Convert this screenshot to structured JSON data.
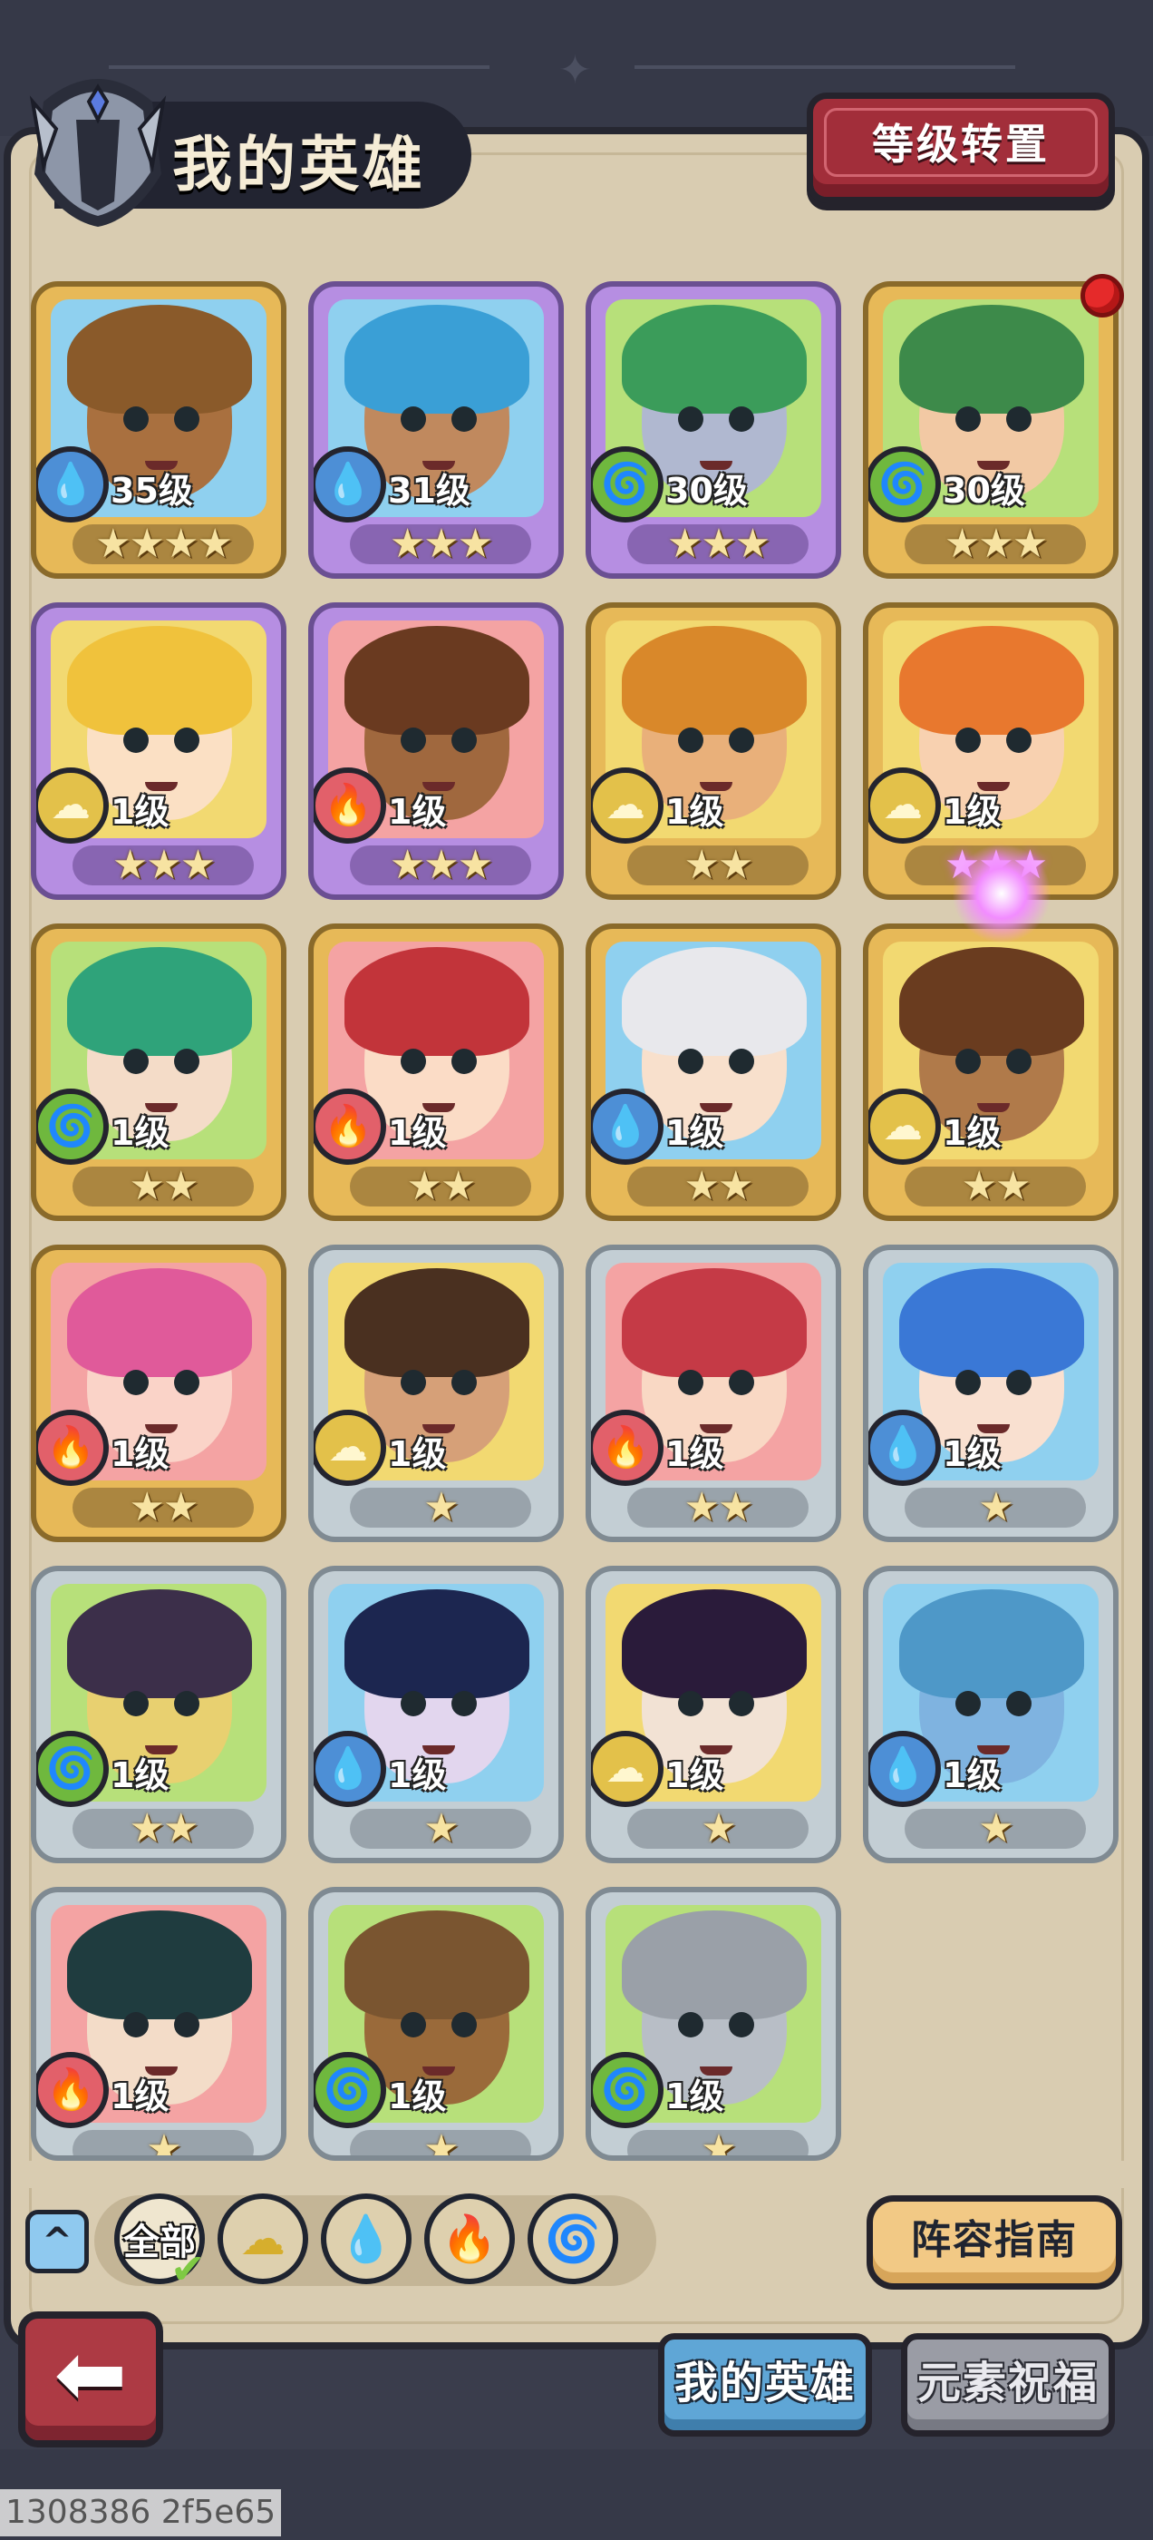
{
  "header": {
    "title": "我的英雄",
    "level_transfer_label": "等级转置",
    "icon": "helmet-icon"
  },
  "heroes": [
    {
      "level": "35级",
      "element": "water",
      "stars": 4,
      "rarity": "gold"
    },
    {
      "level": "31级",
      "element": "water",
      "stars": 3,
      "rarity": "purple"
    },
    {
      "level": "30级",
      "element": "wind",
      "stars": 3,
      "rarity": "purple"
    },
    {
      "level": "30级",
      "element": "wind",
      "stars": 3,
      "rarity": "gold",
      "has_notification": true
    },
    {
      "level": "1级",
      "element": "earth",
      "stars": 3,
      "rarity": "purple"
    },
    {
      "level": "1级",
      "element": "fire",
      "stars": 3,
      "rarity": "purple"
    },
    {
      "level": "1级",
      "element": "earth",
      "stars": 2,
      "rarity": "gold"
    },
    {
      "level": "1级",
      "element": "earth",
      "stars": 3,
      "rarity": "gold",
      "highlight": true
    },
    {
      "level": "1级",
      "element": "wind",
      "stars": 2,
      "rarity": "gold"
    },
    {
      "level": "1级",
      "element": "fire",
      "stars": 2,
      "rarity": "gold"
    },
    {
      "level": "1级",
      "element": "water",
      "stars": 2,
      "rarity": "gold"
    },
    {
      "level": "1级",
      "element": "earth",
      "stars": 2,
      "rarity": "gold"
    },
    {
      "level": "1级",
      "element": "fire",
      "stars": 2,
      "rarity": "gold"
    },
    {
      "level": "1级",
      "element": "earth",
      "stars": 1,
      "rarity": "silver"
    },
    {
      "level": "1级",
      "element": "fire",
      "stars": 2,
      "rarity": "silver"
    },
    {
      "level": "1级",
      "element": "water",
      "stars": 1,
      "rarity": "silver"
    },
    {
      "level": "1级",
      "element": "wind",
      "stars": 2,
      "rarity": "silver"
    },
    {
      "level": "1级",
      "element": "water",
      "stars": 1,
      "rarity": "silver"
    },
    {
      "level": "1级",
      "element": "earth",
      "stars": 1,
      "rarity": "silver"
    },
    {
      "level": "1级",
      "element": "water",
      "stars": 1,
      "rarity": "silver"
    },
    {
      "level": "1级",
      "element": "fire",
      "stars": 1,
      "rarity": "silver"
    },
    {
      "level": "1级",
      "element": "wind",
      "stars": 1,
      "rarity": "silver"
    },
    {
      "level": "1级",
      "element": "wind",
      "stars": 1,
      "rarity": "silver"
    }
  ],
  "filters": {
    "collapse_icon": "chevron-up-icon",
    "all_label": "全部",
    "items": [
      "earth",
      "water",
      "fire",
      "wind"
    ]
  },
  "lineup_guide_label": "阵容指南",
  "tabs": {
    "my_heroes": "我的英雄",
    "element_blessing": "元素祝福"
  },
  "build_id": "1308386 2f5e65",
  "colors": {
    "water": "#4d8fd6",
    "wind": "#6fb83e",
    "earth": "#e3c14a",
    "fire": "#e2606a",
    "gold_card": "#e7b958",
    "purple_card": "#b68ee2",
    "silver_card": "#c3ced4"
  }
}
